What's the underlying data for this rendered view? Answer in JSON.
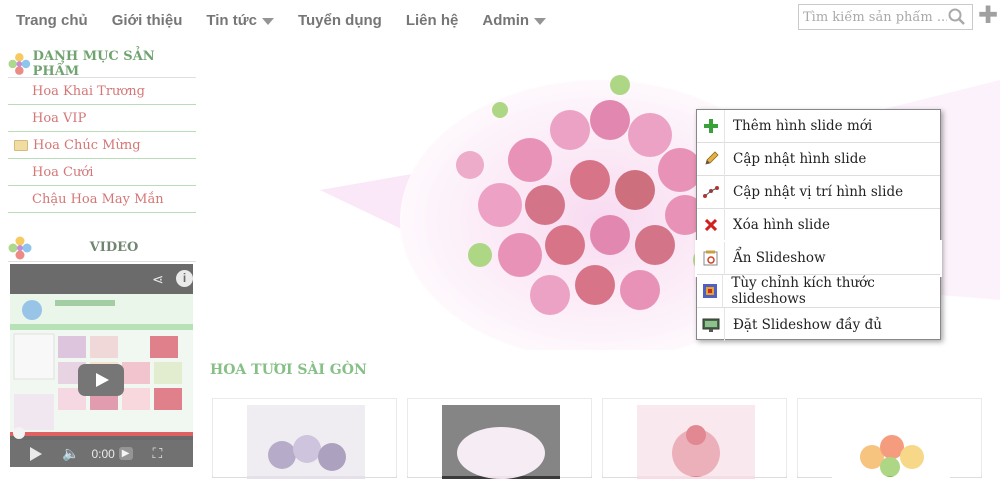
{
  "nav": {
    "items": [
      "Trang chủ",
      "Giới thiệu",
      "Tin tức",
      "Tuyển dụng",
      "Liên hệ",
      "Admin"
    ]
  },
  "search": {
    "placeholder": "Tìm kiếm sản phẩm ..."
  },
  "sidebar": {
    "category_title": "DANH MỤC SẢN PHẨM",
    "items": [
      "Hoa Khai Trương",
      "Hoa VIP",
      "Hoa Chúc Mừng",
      "Hoa Cưới",
      "Chậu Hoa May Mắn"
    ],
    "video_title": "VIDEO",
    "video_time": "0:00"
  },
  "section": {
    "title": "HOA TƯƠI SÀI GÒN"
  },
  "context_menu": {
    "items": [
      {
        "label": "Thêm hình slide mới",
        "icon": "add-icon"
      },
      {
        "label": "Cập nhật hình slide",
        "icon": "pencil-icon"
      },
      {
        "label": "Cập nhật vị trí hình slide",
        "icon": "reorder-icon"
      },
      {
        "label": "Xóa hình slide",
        "icon": "delete-icon"
      },
      {
        "label": "Ẩn Slideshow",
        "icon": "hide-slideshow-icon"
      },
      {
        "label": "Tùy chỉnh kích thước slideshows",
        "icon": "resize-icon"
      },
      {
        "label": "Đặt Slideshow đầy đủ",
        "icon": "fullscreen-slideshow-icon"
      }
    ],
    "highlighted_index": 4
  },
  "colors": {
    "accent_green": "#3c9a3c",
    "category_red": "#b22222",
    "youtube_red": "#cc0000"
  }
}
